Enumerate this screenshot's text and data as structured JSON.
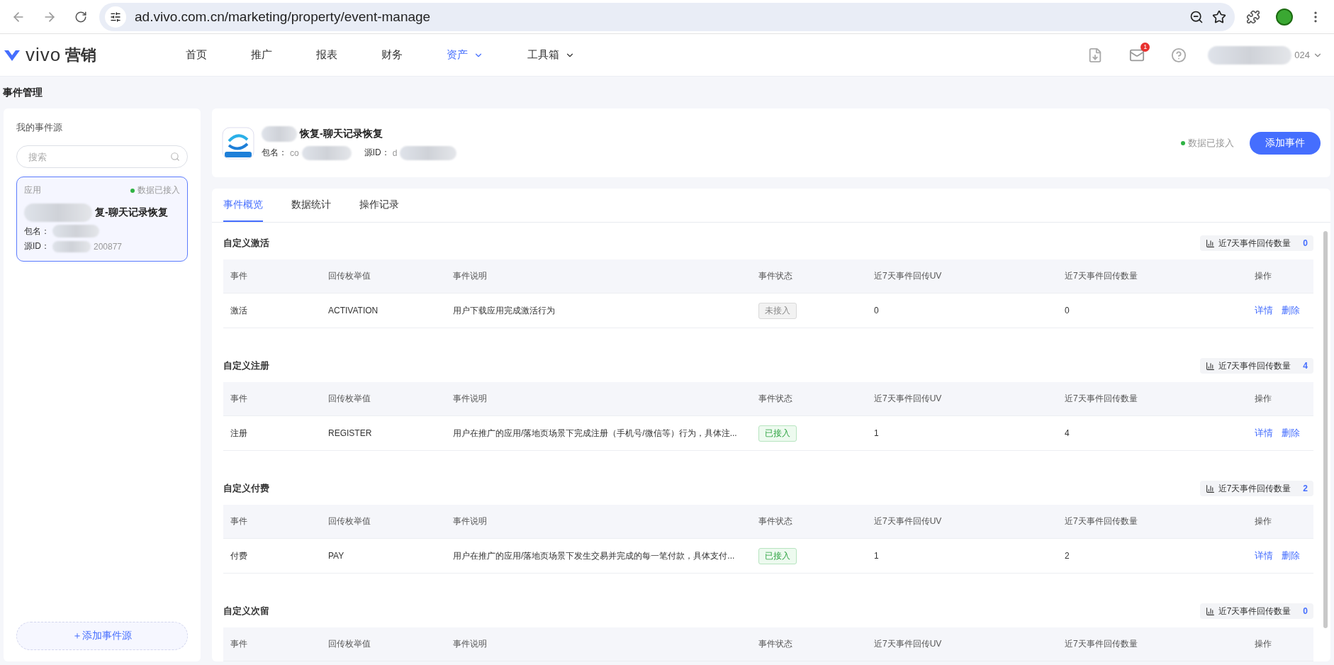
{
  "browser": {
    "url": "ad.vivo.com.cn/marketing/property/event-manage"
  },
  "nav": {
    "brand": "vivo",
    "brand_suffix": "营销",
    "items": [
      {
        "label": "首页",
        "selected": false,
        "dropdown": false
      },
      {
        "label": "推广",
        "selected": false,
        "dropdown": false
      },
      {
        "label": "报表",
        "selected": false,
        "dropdown": false
      },
      {
        "label": "财务",
        "selected": false,
        "dropdown": false
      },
      {
        "label": "资产",
        "selected": true,
        "dropdown": true
      },
      {
        "label": "工具箱",
        "selected": false,
        "dropdown": true
      }
    ],
    "mail_badge": "1",
    "user_text": "024"
  },
  "page_title": "事件管理",
  "sidebar": {
    "title": "我的事件源",
    "search": {
      "placeholder": "搜索"
    },
    "sources": [
      {
        "type": "应用",
        "status": "数据已接入",
        "name": "复-聊天记录恢复",
        "package_label": "包名：",
        "source_id_label": "源ID：",
        "source_id": "200877",
        "selected": true
      }
    ],
    "add_button": "＋添加事件源"
  },
  "header": {
    "app_name": "恢复-聊天记录恢复",
    "package_label": "包名：",
    "package_value": "co",
    "source_id_label": "源ID：",
    "source_id_value": "d",
    "status": "数据已接入",
    "add_button": "添加事件"
  },
  "tabs": [
    {
      "label": "事件概览",
      "selected": true
    },
    {
      "label": "数据统计",
      "selected": false
    },
    {
      "label": "操作记录",
      "selected": false
    }
  ],
  "sections": [
    {
      "title": "自定义激活",
      "summary_label": "近7天事件回传数量",
      "summary_count": "0",
      "columns": [
        "事件",
        "回传枚举值",
        "事件说明",
        "事件状态",
        "近7天事件回传UV",
        "近7天事件回传数量",
        "操作"
      ],
      "rows": [
        {
          "event": "激活",
          "enum": "ACTIVATION",
          "description": "用户下载应用完成激活行为",
          "status": "未接入",
          "connected": false,
          "uv": "0",
          "count": "0",
          "actions": [
            "详情",
            "删除"
          ]
        }
      ]
    },
    {
      "title": "自定义注册",
      "summary_label": "近7天事件回传数量",
      "summary_count": "4",
      "columns": [
        "事件",
        "回传枚举值",
        "事件说明",
        "事件状态",
        "近7天事件回传UV",
        "近7天事件回传数量",
        "操作"
      ],
      "rows": [
        {
          "event": "注册",
          "enum": "REGISTER",
          "description": "用户在推广的应用/落地页场景下完成注册（手机号/微信等）行为，具体注...",
          "status": "已接入",
          "connected": true,
          "uv": "1",
          "count": "4",
          "actions": [
            "详情",
            "删除"
          ]
        }
      ]
    },
    {
      "title": "自定义付费",
      "summary_label": "近7天事件回传数量",
      "summary_count": "2",
      "columns": [
        "事件",
        "回传枚举值",
        "事件说明",
        "事件状态",
        "近7天事件回传UV",
        "近7天事件回传数量",
        "操作"
      ],
      "rows": [
        {
          "event": "付费",
          "enum": "PAY",
          "description": "用户在推广的应用/落地页场景下发生交易并完成的每一笔付款，具体支付...",
          "status": "已接入",
          "connected": true,
          "uv": "1",
          "count": "2",
          "actions": [
            "详情",
            "删除"
          ]
        }
      ]
    },
    {
      "title": "自定义次留",
      "summary_label": "近7天事件回传数量",
      "summary_count": "0",
      "columns": [
        "事件",
        "回传枚举值",
        "事件说明",
        "事件状态",
        "近7天事件回传UV",
        "近7天事件回传数量",
        "操作"
      ]
    }
  ]
}
